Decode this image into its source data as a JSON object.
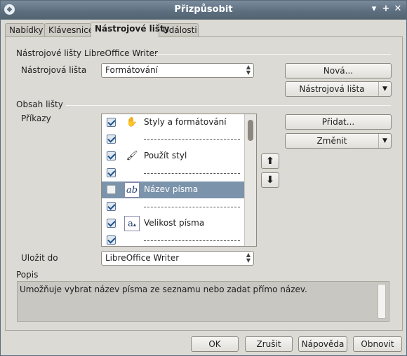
{
  "window": {
    "title": "Přizpůsobit"
  },
  "tabs": [
    {
      "label": "Nabídky"
    },
    {
      "label": "Klávesnice"
    },
    {
      "label": "Nástrojové lišty"
    },
    {
      "label": "Události"
    }
  ],
  "toolbars_section": {
    "heading": "Nástrojové lišty LibreOffice Writer",
    "toolbar_label": "Nástrojová lišta",
    "toolbar_value": "Formátování",
    "new_button": "Nová...",
    "toolbar_menu_button": "Nástrojová lišta"
  },
  "content_section": {
    "heading": "Obsah lišty",
    "commands_label": "Příkazy",
    "add_button": "Přidat...",
    "modify_button": "Změnit",
    "rows": [
      {
        "type": "item",
        "checked": true,
        "icon": "styles-formatting-icon",
        "label": "Styly a formátování",
        "selected": false
      },
      {
        "type": "separator",
        "checked": true,
        "selected": false
      },
      {
        "type": "item",
        "checked": true,
        "icon": "apply-style-icon",
        "label": "Použít styl",
        "selected": false
      },
      {
        "type": "separator",
        "checked": true,
        "selected": false
      },
      {
        "type": "item",
        "checked": false,
        "icon": "font-name-icon",
        "label": "Název písma",
        "selected": true
      },
      {
        "type": "separator",
        "checked": true,
        "selected": false
      },
      {
        "type": "item",
        "checked": true,
        "icon": "font-size-icon",
        "label": "Velikost písma",
        "selected": false
      },
      {
        "type": "separator",
        "checked": true,
        "selected": false
      }
    ]
  },
  "save_in": {
    "label": "Uložit do",
    "value": "LibreOffice Writer"
  },
  "description": {
    "label": "Popis",
    "text": "Umožňuje vybrat název písma ze seznamu nebo zadat přímo název."
  },
  "footer": {
    "ok": "OK",
    "cancel": "Zrušit",
    "help": "Nápověda",
    "reset": "Obnovit"
  },
  "colors": {
    "selection": "#7b93ab",
    "titlebar": "#5d6f80"
  }
}
